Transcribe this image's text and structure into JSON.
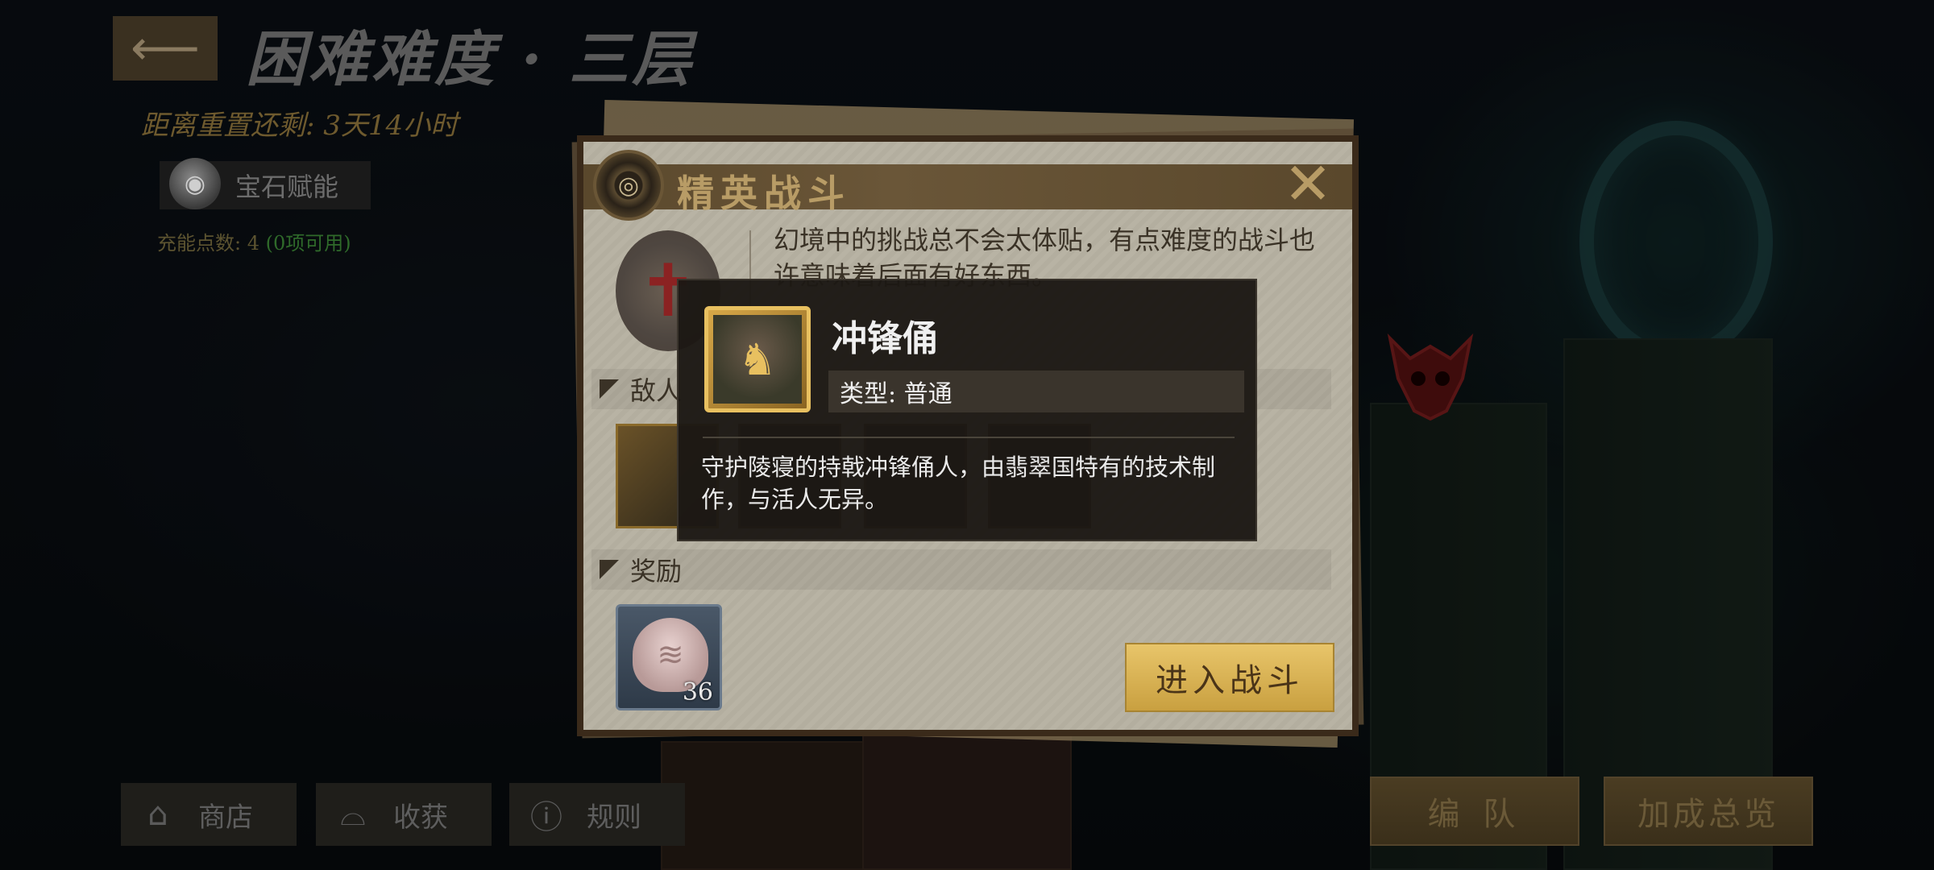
{
  "header": {
    "back_icon": "arrow-left-icon",
    "title": "困难难度 · 三层",
    "reset_text": "距离重置还剩: 3天14小时"
  },
  "gem": {
    "label": "宝石赋能",
    "charge_label": "充能点数: 4",
    "charge_available": "(0项可用)"
  },
  "bottom_left": [
    {
      "icon": "shop-icon",
      "label": "商店"
    },
    {
      "icon": "basket-icon",
      "label": "收获"
    },
    {
      "icon": "exclamation-icon",
      "label": "规则"
    }
  ],
  "bottom_right": {
    "team_label": "编 队",
    "bonus_label": "加成总览"
  },
  "dialog": {
    "title": "精英战斗",
    "description": "幻境中的挑战总不会太体贴，有点难度的战斗也许意味着后面有好东西。",
    "enemy_section": "敌人",
    "reward_section": "奖励",
    "reward_count": "36",
    "enter_label": "进入战斗"
  },
  "tooltip": {
    "name": "冲锋俑",
    "type": "类型: 普通",
    "description": "守护陵寝的持戟冲锋俑人，由翡翠国特有的技术制作，与活人无异。"
  },
  "colors": {
    "gold_button": "#e8c56a",
    "dialog_paper": "#b8b3a4",
    "elite_red": "#8b2222"
  }
}
